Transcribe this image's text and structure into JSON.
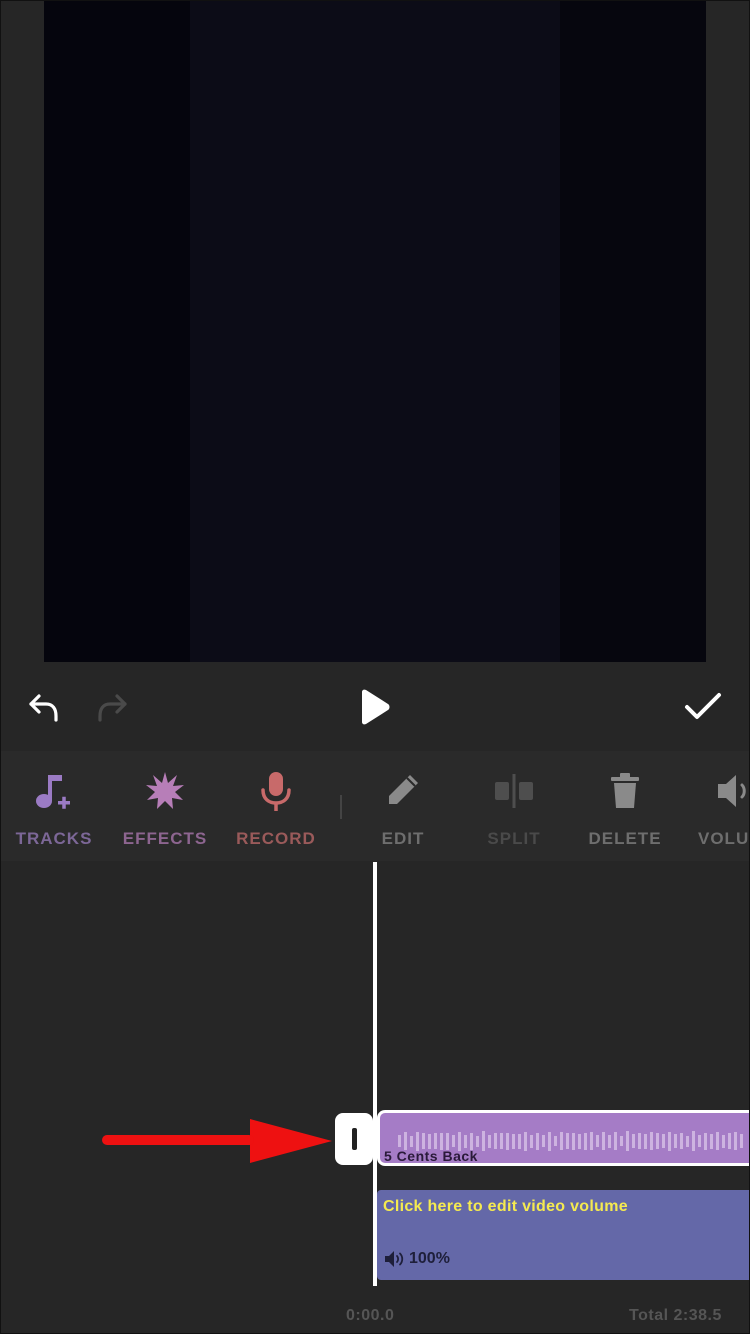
{
  "controls": {
    "undo_icon": "undo-arrow-icon",
    "redo_icon": "redo-arrow-icon",
    "play_icon": "play-icon",
    "done_icon": "checkmark-icon"
  },
  "toolbar": {
    "items": [
      {
        "label": "TRACKS",
        "icon": "music-note-plus-icon",
        "color": "#9b7bc4"
      },
      {
        "label": "EFFECTS",
        "icon": "starburst-icon",
        "color": "#b77eb8"
      },
      {
        "label": "RECORD",
        "icon": "microphone-icon",
        "color": "#c86a6a"
      },
      {
        "label": "EDIT",
        "icon": "pencil-icon",
        "color": "#8a8a8a"
      },
      {
        "label": "SPLIT",
        "icon": "split-icon",
        "color": "#4e4e4e"
      },
      {
        "label": "DELETE",
        "icon": "trash-icon",
        "color": "#8a8a8a"
      },
      {
        "label": "VOLU",
        "icon": "speaker-icon",
        "color": "#8a8a8a"
      }
    ]
  },
  "timeline": {
    "audio_clip": {
      "name": "5 Cents Back",
      "color": "#a57cc6"
    },
    "video_clip": {
      "hint": "Click here to edit video volume",
      "volume": "100%",
      "color": "#6468a8"
    },
    "current_time": "0:00.0",
    "total": "Total 2:38.5"
  },
  "colors": {
    "annotation_arrow": "#ee1111"
  }
}
